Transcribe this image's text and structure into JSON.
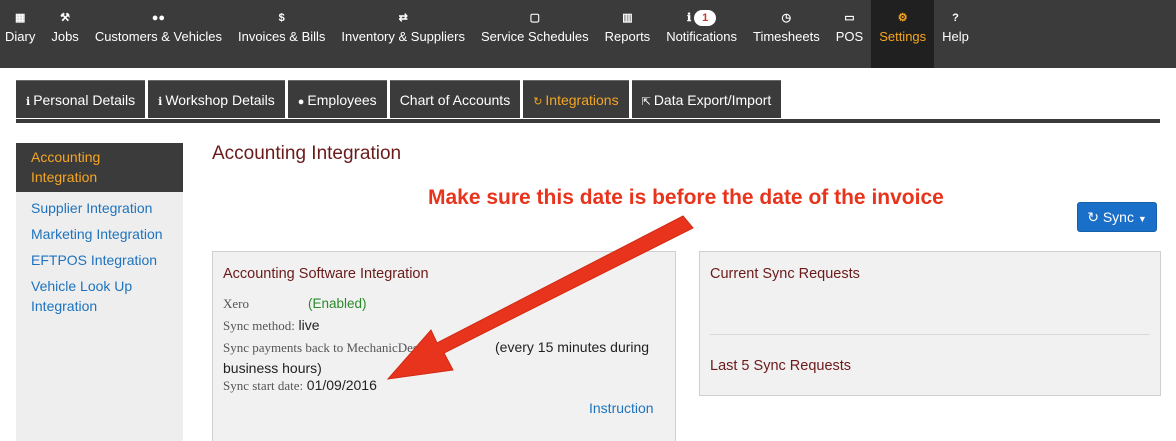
{
  "topnav": [
    {
      "id": "diary",
      "label": "Diary",
      "icon": "calendar-icon",
      "glyph": "▦"
    },
    {
      "id": "jobs",
      "label": "Jobs",
      "icon": "wrench-icon",
      "glyph": "⚒"
    },
    {
      "id": "customers",
      "label": "Customers & Vehicles",
      "icon": "users-icon",
      "glyph": "●●"
    },
    {
      "id": "invoices",
      "label": "Invoices & Bills",
      "icon": "dollar-icon",
      "glyph": "$"
    },
    {
      "id": "inventory",
      "label": "Inventory & Suppliers",
      "icon": "exchange-icon",
      "glyph": "⇄"
    },
    {
      "id": "schedules",
      "label": "Service Schedules",
      "icon": "calendar-outline-icon",
      "glyph": "▢"
    },
    {
      "id": "reports",
      "label": "Reports",
      "icon": "bar-chart-icon",
      "glyph": "▥"
    },
    {
      "id": "notifications",
      "label": "Notifications",
      "icon": "info-icon",
      "glyph": "ℹ",
      "badge": "1"
    },
    {
      "id": "timesheets",
      "label": "Timesheets",
      "icon": "clock-icon",
      "glyph": "◷"
    },
    {
      "id": "pos",
      "label": "POS",
      "icon": "money-icon",
      "glyph": "▭"
    },
    {
      "id": "settings",
      "label": "Settings",
      "icon": "cogs-icon",
      "glyph": "⚙",
      "active": true
    },
    {
      "id": "help",
      "label": "Help",
      "icon": "question-icon",
      "glyph": "?"
    }
  ],
  "tabs": [
    {
      "id": "personal",
      "label": "Personal Details",
      "glyph": "ℹ",
      "icon": "info-circle-icon"
    },
    {
      "id": "workshop",
      "label": "Workshop Details",
      "glyph": "ℹ",
      "icon": "info-circle-icon"
    },
    {
      "id": "employees",
      "label": "Employees",
      "glyph": "●",
      "icon": "user-icon"
    },
    {
      "id": "chart",
      "label": "Chart of Accounts",
      "glyph": "",
      "icon": ""
    },
    {
      "id": "integrations",
      "label": "Integrations",
      "glyph": "↻",
      "icon": "refresh-icon",
      "active": true
    },
    {
      "id": "export",
      "label": "Data Export/Import",
      "glyph": "⇱",
      "icon": "share-icon"
    }
  ],
  "sidebar": [
    {
      "label": "Accounting Integration",
      "active": true
    },
    {
      "label": "Supplier Integration"
    },
    {
      "label": "Marketing Integration"
    },
    {
      "label": "EFTPOS Integration"
    },
    {
      "label": "Vehicle Look Up Integration"
    }
  ],
  "main": {
    "title": "Accounting Integration",
    "sync_label": "Sync",
    "annotation": "Make sure this date is before the date of the invoice"
  },
  "accounting_panel": {
    "title": "Accounting Software Integration",
    "software_label": "Xero",
    "software_status": "(Enabled)",
    "sync_method_label": "Sync method:",
    "sync_method_value": "live",
    "sync_payments_label": "Sync payments back to MechanicDesk:",
    "sync_payments_value_partial": "y",
    "sync_payments_detail": "(every 15 minutes during business hours)",
    "sync_start_label": "Sync start date:",
    "sync_start_value": "01/09/2016",
    "instruction_link": "Instruction"
  },
  "sync_panel": {
    "current_title": "Current Sync Requests",
    "last_title": "Last 5 Sync Requests"
  },
  "colors": {
    "nav_bg": "#3b3b3b",
    "active_orange": "#f5a623",
    "link_blue": "#1e73be",
    "title_maroon": "#6b1a1a",
    "annotation_red": "#e8341c",
    "button_blue": "#1a6fc9"
  }
}
